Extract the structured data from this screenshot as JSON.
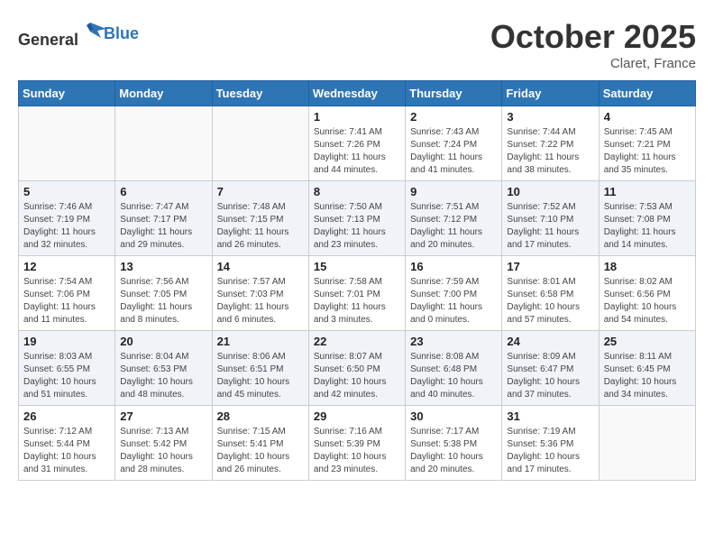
{
  "header": {
    "logo_general": "General",
    "logo_blue": "Blue",
    "month_title": "October 2025",
    "location": "Claret, France"
  },
  "weekdays": [
    "Sunday",
    "Monday",
    "Tuesday",
    "Wednesday",
    "Thursday",
    "Friday",
    "Saturday"
  ],
  "weeks": [
    [
      {
        "day": "",
        "info": ""
      },
      {
        "day": "",
        "info": ""
      },
      {
        "day": "",
        "info": ""
      },
      {
        "day": "1",
        "info": "Sunrise: 7:41 AM\nSunset: 7:26 PM\nDaylight: 11 hours and 44 minutes."
      },
      {
        "day": "2",
        "info": "Sunrise: 7:43 AM\nSunset: 7:24 PM\nDaylight: 11 hours and 41 minutes."
      },
      {
        "day": "3",
        "info": "Sunrise: 7:44 AM\nSunset: 7:22 PM\nDaylight: 11 hours and 38 minutes."
      },
      {
        "day": "4",
        "info": "Sunrise: 7:45 AM\nSunset: 7:21 PM\nDaylight: 11 hours and 35 minutes."
      }
    ],
    [
      {
        "day": "5",
        "info": "Sunrise: 7:46 AM\nSunset: 7:19 PM\nDaylight: 11 hours and 32 minutes."
      },
      {
        "day": "6",
        "info": "Sunrise: 7:47 AM\nSunset: 7:17 PM\nDaylight: 11 hours and 29 minutes."
      },
      {
        "day": "7",
        "info": "Sunrise: 7:48 AM\nSunset: 7:15 PM\nDaylight: 11 hours and 26 minutes."
      },
      {
        "day": "8",
        "info": "Sunrise: 7:50 AM\nSunset: 7:13 PM\nDaylight: 11 hours and 23 minutes."
      },
      {
        "day": "9",
        "info": "Sunrise: 7:51 AM\nSunset: 7:12 PM\nDaylight: 11 hours and 20 minutes."
      },
      {
        "day": "10",
        "info": "Sunrise: 7:52 AM\nSunset: 7:10 PM\nDaylight: 11 hours and 17 minutes."
      },
      {
        "day": "11",
        "info": "Sunrise: 7:53 AM\nSunset: 7:08 PM\nDaylight: 11 hours and 14 minutes."
      }
    ],
    [
      {
        "day": "12",
        "info": "Sunrise: 7:54 AM\nSunset: 7:06 PM\nDaylight: 11 hours and 11 minutes."
      },
      {
        "day": "13",
        "info": "Sunrise: 7:56 AM\nSunset: 7:05 PM\nDaylight: 11 hours and 8 minutes."
      },
      {
        "day": "14",
        "info": "Sunrise: 7:57 AM\nSunset: 7:03 PM\nDaylight: 11 hours and 6 minutes."
      },
      {
        "day": "15",
        "info": "Sunrise: 7:58 AM\nSunset: 7:01 PM\nDaylight: 11 hours and 3 minutes."
      },
      {
        "day": "16",
        "info": "Sunrise: 7:59 AM\nSunset: 7:00 PM\nDaylight: 11 hours and 0 minutes."
      },
      {
        "day": "17",
        "info": "Sunrise: 8:01 AM\nSunset: 6:58 PM\nDaylight: 10 hours and 57 minutes."
      },
      {
        "day": "18",
        "info": "Sunrise: 8:02 AM\nSunset: 6:56 PM\nDaylight: 10 hours and 54 minutes."
      }
    ],
    [
      {
        "day": "19",
        "info": "Sunrise: 8:03 AM\nSunset: 6:55 PM\nDaylight: 10 hours and 51 minutes."
      },
      {
        "day": "20",
        "info": "Sunrise: 8:04 AM\nSunset: 6:53 PM\nDaylight: 10 hours and 48 minutes."
      },
      {
        "day": "21",
        "info": "Sunrise: 8:06 AM\nSunset: 6:51 PM\nDaylight: 10 hours and 45 minutes."
      },
      {
        "day": "22",
        "info": "Sunrise: 8:07 AM\nSunset: 6:50 PM\nDaylight: 10 hours and 42 minutes."
      },
      {
        "day": "23",
        "info": "Sunrise: 8:08 AM\nSunset: 6:48 PM\nDaylight: 10 hours and 40 minutes."
      },
      {
        "day": "24",
        "info": "Sunrise: 8:09 AM\nSunset: 6:47 PM\nDaylight: 10 hours and 37 minutes."
      },
      {
        "day": "25",
        "info": "Sunrise: 8:11 AM\nSunset: 6:45 PM\nDaylight: 10 hours and 34 minutes."
      }
    ],
    [
      {
        "day": "26",
        "info": "Sunrise: 7:12 AM\nSunset: 5:44 PM\nDaylight: 10 hours and 31 minutes."
      },
      {
        "day": "27",
        "info": "Sunrise: 7:13 AM\nSunset: 5:42 PM\nDaylight: 10 hours and 28 minutes."
      },
      {
        "day": "28",
        "info": "Sunrise: 7:15 AM\nSunset: 5:41 PM\nDaylight: 10 hours and 26 minutes."
      },
      {
        "day": "29",
        "info": "Sunrise: 7:16 AM\nSunset: 5:39 PM\nDaylight: 10 hours and 23 minutes."
      },
      {
        "day": "30",
        "info": "Sunrise: 7:17 AM\nSunset: 5:38 PM\nDaylight: 10 hours and 20 minutes."
      },
      {
        "day": "31",
        "info": "Sunrise: 7:19 AM\nSunset: 5:36 PM\nDaylight: 10 hours and 17 minutes."
      },
      {
        "day": "",
        "info": ""
      }
    ]
  ]
}
